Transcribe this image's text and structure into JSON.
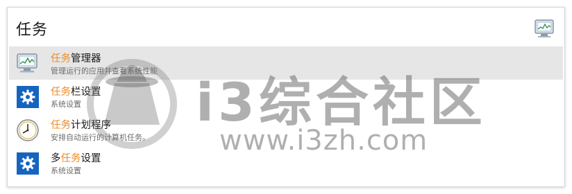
{
  "panel": {
    "title": "任务",
    "icon": "task-manager-icon"
  },
  "results": [
    {
      "icon": "task-manager-icon",
      "title_parts": [
        {
          "text": "任务",
          "highlight": true
        },
        {
          "text": "管理器",
          "highlight": false
        }
      ],
      "subtitle": "管理运行的应用并查看系统性能",
      "selected": true
    },
    {
      "icon": "gear-icon",
      "title_parts": [
        {
          "text": "任务",
          "highlight": true
        },
        {
          "text": "栏设置",
          "highlight": false
        }
      ],
      "subtitle": "系统设置",
      "selected": false
    },
    {
      "icon": "clock-icon",
      "title_parts": [
        {
          "text": "任务",
          "highlight": true
        },
        {
          "text": "计划程序",
          "highlight": false
        }
      ],
      "subtitle": "安排自动运行的计算机任务。",
      "selected": false
    },
    {
      "icon": "gear-icon",
      "title_parts": [
        {
          "text": "多",
          "highlight": false
        },
        {
          "text": "任务",
          "highlight": true
        },
        {
          "text": "设置",
          "highlight": false
        }
      ],
      "subtitle": "系统设置",
      "selected": false
    }
  ],
  "watermark": {
    "main_text": "i3综合社区",
    "url_text": "www.i3zh.com"
  },
  "colors": {
    "highlight": "#f08a24",
    "selected_row": "#e6e6e6",
    "settings_icon_bg": "#1565c0"
  }
}
